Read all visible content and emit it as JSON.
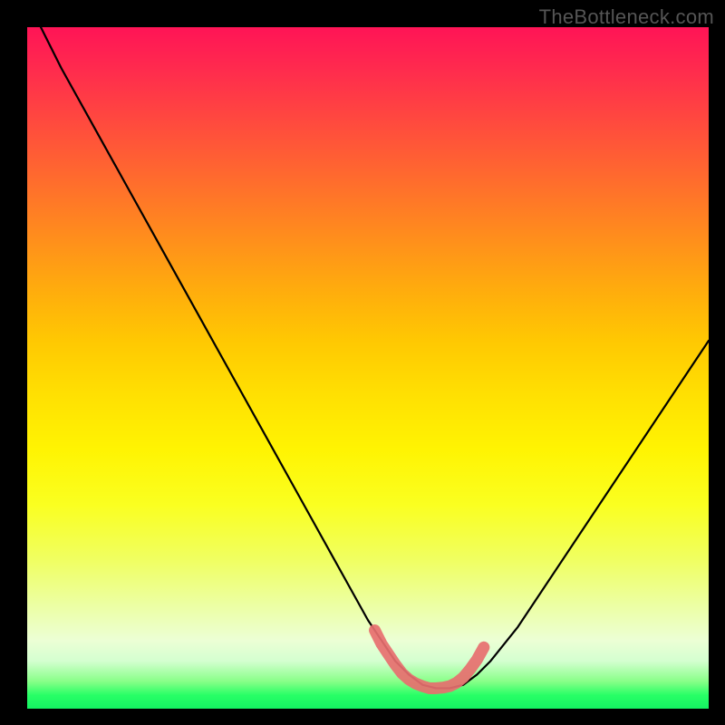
{
  "watermark": "TheBottleneck.com",
  "chart_data": {
    "type": "line",
    "title": "",
    "xlabel": "",
    "ylabel": "",
    "xlim": [
      0,
      100
    ],
    "ylim": [
      0,
      100
    ],
    "grid": false,
    "series": [
      {
        "name": "bottleneck-curve",
        "color": "#000000",
        "x": [
          2,
          5,
          10,
          15,
          20,
          25,
          30,
          35,
          40,
          45,
          50,
          52,
          54,
          56,
          58,
          60,
          62,
          64,
          66,
          68,
          72,
          76,
          80,
          84,
          88,
          92,
          96,
          100
        ],
        "values": [
          100,
          94,
          85,
          76,
          67,
          58,
          49,
          40,
          31,
          22,
          13,
          10,
          7,
          5,
          3.5,
          3,
          3,
          3.5,
          5,
          7,
          12,
          18,
          24,
          30,
          36,
          42,
          48,
          54
        ]
      },
      {
        "name": "optimal-range-marker",
        "color": "#e57373",
        "x": [
          51,
          52,
          53,
          54,
          55,
          56,
          57,
          58,
          59,
          60,
          61,
          62,
          63,
          64,
          65,
          66,
          67
        ],
        "values": [
          11.5,
          9.5,
          8,
          6.5,
          5.2,
          4.3,
          3.7,
          3.3,
          3.0,
          3.0,
          3.1,
          3.3,
          3.8,
          4.6,
          5.8,
          7.2,
          9
        ]
      }
    ],
    "gradient_stops": [
      {
        "pos": 0,
        "color": "#ff1456"
      },
      {
        "pos": 50,
        "color": "#ffe002"
      },
      {
        "pos": 100,
        "color": "#14f262"
      }
    ]
  }
}
